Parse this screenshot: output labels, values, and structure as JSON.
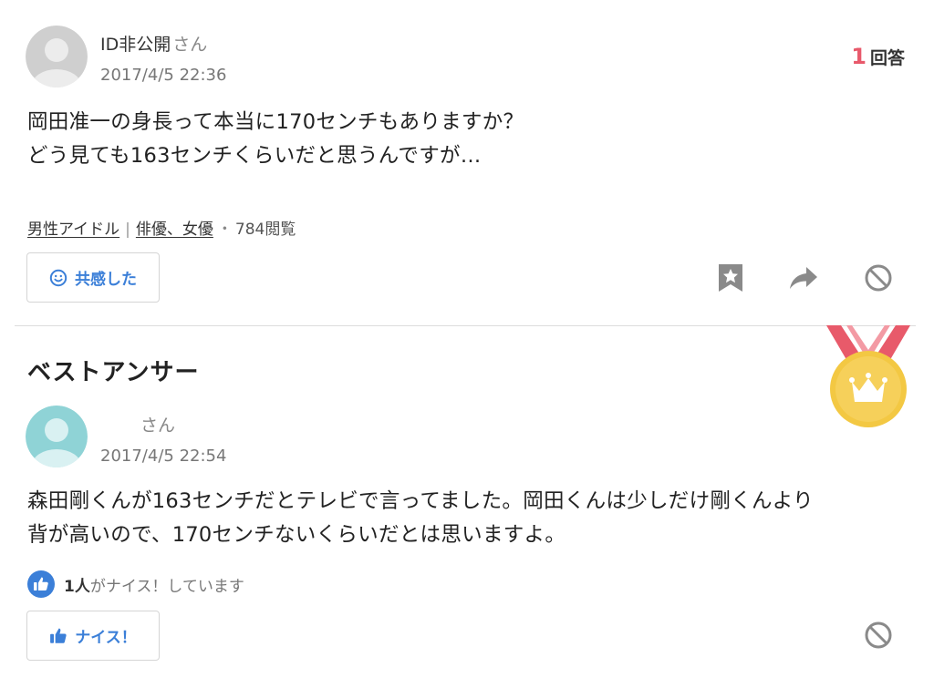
{
  "question": {
    "user_name": "ID非公開",
    "honorific": "さん",
    "datetime": "2017/4/5 22:36",
    "answer_count_num": "1",
    "answer_count_label": "回答",
    "text_line1": "岡田准一の身長って本当に170センチもありますか？",
    "text_line2": "どう見ても163センチくらいだと思うんですが…",
    "tags": [
      "男性アイドル",
      "俳優、女優"
    ],
    "tag_separator": "|",
    "dot": "・",
    "views": "784閲覧",
    "empathy_label": "共感した"
  },
  "best_answer": {
    "section_title": "ベストアンサー",
    "honorific": "さん",
    "datetime": "2017/4/5 22:54",
    "text_line1": "森田剛くんが163センチだとテレビで言ってました。岡田くんは少しだけ剛くんより",
    "text_line2": "背が高いので、170センチないくらいだとは思いますよ。",
    "like_count": "1人",
    "like_suffix": "がナイス！しています",
    "nice_label": "ナイス！"
  },
  "icons": {
    "bookmark": "bookmark-star-icon",
    "share": "share-arrow-icon",
    "ban": "prohibited-icon",
    "medal": "crown-medal-icon",
    "smile": "smile-icon",
    "thumbs_up": "thumbs-up-icon"
  },
  "colors": {
    "accent_blue": "#3b7fd8",
    "answer_count_red": "#e8596b",
    "medal_gold": "#f3c843",
    "ribbon_red": "#e85a6a",
    "avatar_gray": "#cfcfcf",
    "avatar_teal": "#8fd3d6"
  }
}
